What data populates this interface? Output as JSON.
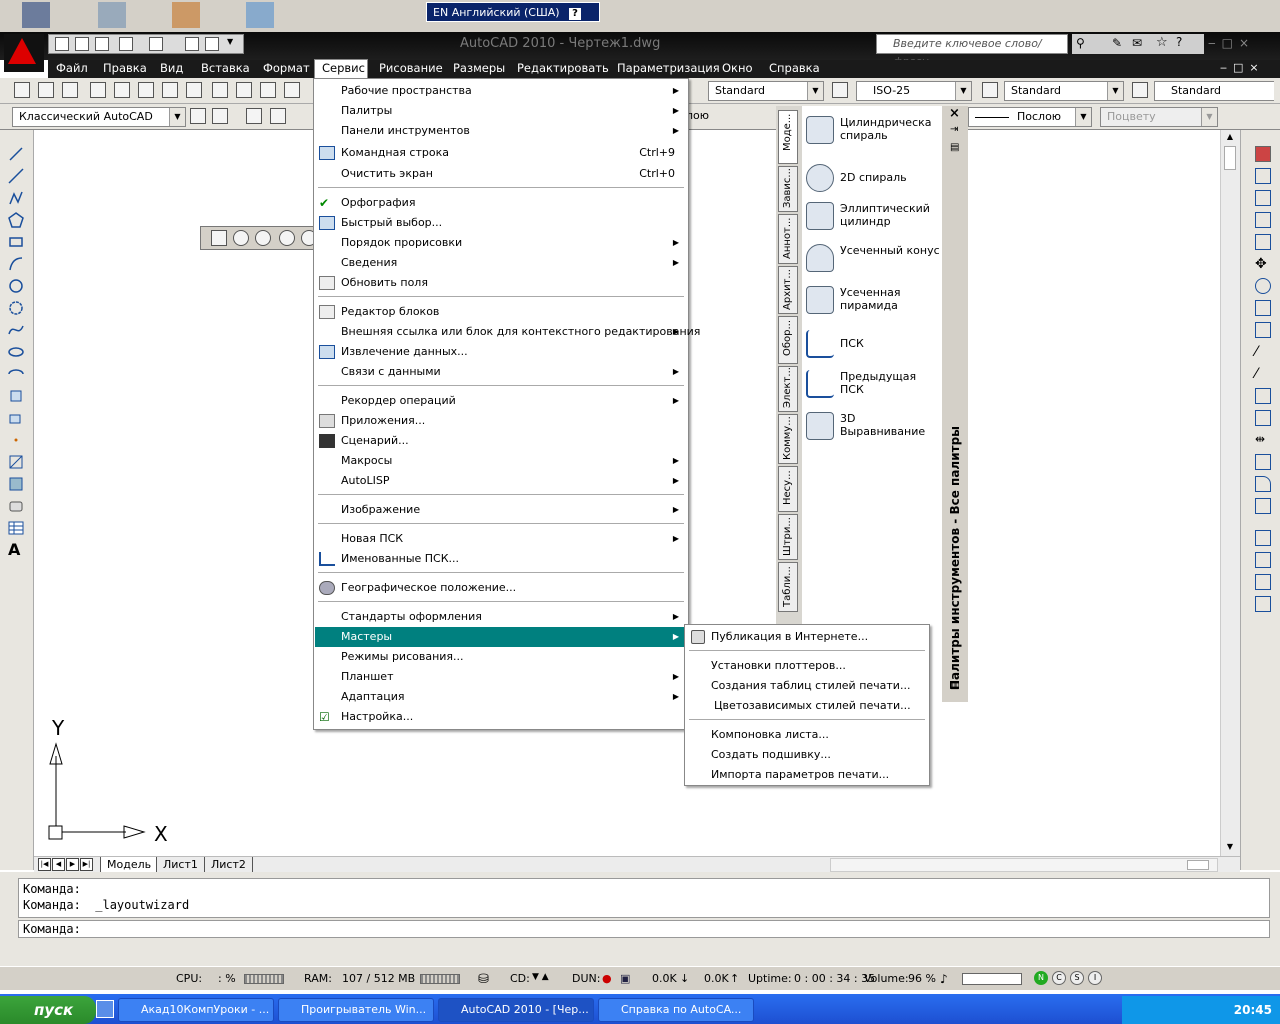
{
  "language_bar": {
    "code": "EN",
    "name": "Английский (США)",
    "help": "?"
  },
  "app": {
    "title": "AutoCAD 2010 - Чертеж1.dwg"
  },
  "search": {
    "placeholder": "Введите ключевое слово/фразу"
  },
  "menubar": [
    "Файл",
    "Правка",
    "Вид",
    "Вставка",
    "Формат",
    "Сервис",
    "Рисование",
    "Размеры",
    "Редактировать",
    "Параметризация",
    "Окно",
    "Справка"
  ],
  "toolbar1": {
    "text_style": "Standard",
    "dim_style": "ISO-25",
    "table_style": "Standard",
    "mleader_style": "Standard"
  },
  "toolbar2": {
    "workspace": "Классический AutoCAD",
    "linetype_partial": "лою",
    "lineweight": "Послою",
    "plotstyle": "Поцвету"
  },
  "servis_menu": {
    "items": [
      {
        "label": "Рабочие пространства",
        "shortcut": "",
        "submenu": true
      },
      {
        "label": "Палитры",
        "shortcut": "",
        "submenu": true
      },
      {
        "label": "Панели инструментов",
        "shortcut": "",
        "submenu": true
      },
      {
        "label": "Командная строка",
        "shortcut": "Ctrl+9",
        "submenu": false
      },
      {
        "label": "Очистить экран",
        "shortcut": "Ctrl+0",
        "submenu": false
      },
      {
        "label": "Орфография",
        "shortcut": "",
        "submenu": false
      },
      {
        "label": "Быстрый выбор...",
        "shortcut": "",
        "submenu": false
      },
      {
        "label": "Порядок прорисовки",
        "shortcut": "",
        "submenu": true
      },
      {
        "label": "Сведения",
        "shortcut": "",
        "submenu": true
      },
      {
        "label": "Обновить поля",
        "shortcut": "",
        "submenu": false
      },
      {
        "label": "Редактор блоков",
        "shortcut": "",
        "submenu": false
      },
      {
        "label": "Внешняя ссылка или блок для контекстного редактирования",
        "shortcut": "",
        "submenu": true
      },
      {
        "label": "Извлечение данных...",
        "shortcut": "",
        "submenu": false
      },
      {
        "label": "Связи с данными",
        "shortcut": "",
        "submenu": true
      },
      {
        "label": "Рекордер операций",
        "shortcut": "",
        "submenu": true
      },
      {
        "label": "Приложения...",
        "shortcut": "",
        "submenu": false
      },
      {
        "label": "Сценарий...",
        "shortcut": "",
        "submenu": false
      },
      {
        "label": "Макросы",
        "shortcut": "",
        "submenu": true
      },
      {
        "label": "AutoLISP",
        "shortcut": "",
        "submenu": true
      },
      {
        "label": "Изображение",
        "shortcut": "",
        "submenu": true
      },
      {
        "label": "Новая ПСК",
        "shortcut": "",
        "submenu": true
      },
      {
        "label": "Именованные ПСК...",
        "shortcut": "",
        "submenu": false
      },
      {
        "label": "Географическое положение...",
        "shortcut": "",
        "submenu": false
      },
      {
        "label": "Стандарты оформления",
        "shortcut": "",
        "submenu": true
      },
      {
        "label": "Мастеры",
        "shortcut": "",
        "submenu": true
      },
      {
        "label": "Режимы рисования...",
        "shortcut": "",
        "submenu": false
      },
      {
        "label": "Планшет",
        "shortcut": "",
        "submenu": true
      },
      {
        "label": "Адаптация",
        "shortcut": "",
        "submenu": true
      },
      {
        "label": "Настройка...",
        "shortcut": "",
        "submenu": false
      }
    ]
  },
  "wizards_submenu": {
    "items": [
      "Публикация в Интернете...",
      "Установки плоттеров...",
      "Создания таблиц стилей печати...",
      "Цветозависимых стилей печати...",
      "Компоновка листа...",
      "Создать подшивку...",
      "Импорта параметров печати..."
    ]
  },
  "tool_palette": {
    "title": "Палитры инструментов - Все палитры",
    "tabs": [
      "Моде...",
      "Завис...",
      "Аннот...",
      "Архит...",
      "Обор...",
      "Элект...",
      "Комму...",
      "Несу...",
      "Штри...",
      "Табли..."
    ],
    "items": [
      "Цилиндрическа спираль",
      "2D спираль",
      "Эллиптический цилиндр",
      "Усеченный конус",
      "Усеченная пирамида",
      "ПСК",
      "Предыдущая ПСК",
      "3D Выравнивание"
    ]
  },
  "ucs": {
    "y": "Y",
    "x": "X"
  },
  "layout_tabs": [
    "Модель",
    "Лист1",
    "Лист2"
  ],
  "command": {
    "history": [
      "Команда:",
      "Команда:  _layoutwizard"
    ],
    "prompt": "Команда:"
  },
  "statusbar": {
    "cpu_label": "CPU:",
    "cpu_value": ": %",
    "ram_label": "RAM:",
    "ram_value": "107 / 512 MB",
    "cd_label": "CD:",
    "dun_label": "DUN:",
    "down": "0.0K",
    "up": "0.0K",
    "uptime_label": "Uptime:",
    "uptime": "0 : 00 : 34 : 35",
    "volume_label": "Volume:",
    "volume": "96 %"
  },
  "taskbar": {
    "start": "пуск",
    "buttons": [
      "Акад10КомпУроки - ...",
      "Проигрыватель Win...",
      "AutoCAD 2010 - [Чер...",
      "Справка по AutoCA..."
    ],
    "clock": "20:45"
  },
  "colors": {
    "menu_selection": "#00807f",
    "menubar_bg": "#1a1a1a",
    "taskbar": "#2a6ef0",
    "start": "#3ca43c"
  }
}
